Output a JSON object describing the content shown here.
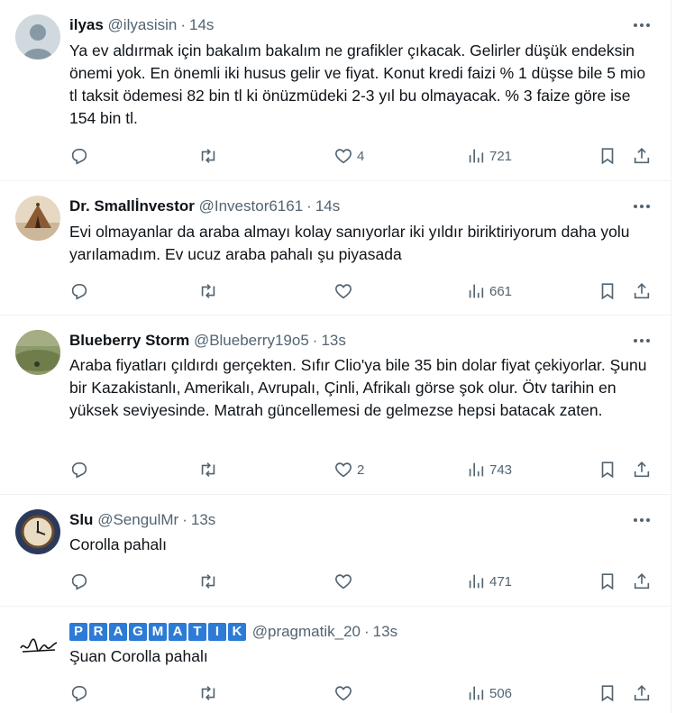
{
  "tweets": [
    {
      "name": "ilyas",
      "handle": "@ilyasisin",
      "time": "14s",
      "text": "Ya ev aldırmak için bakalım bakalım ne grafikler çıkacak. Gelirler düşük endeksin önemi yok. En önemli iki husus gelir ve fiyat. Konut kredi faizi % 1 düşse bile 5 mio tl taksit ödemesi 82 bin tl ki önüzmüdeki 2-3 yıl bu olmayacak. % 3 faize göre ise 154 bin tl.",
      "likes": "4",
      "views": "721",
      "avatar": "default-avatar"
    },
    {
      "name": "Dr. Smallİnvestor",
      "handle": "@Investor6161",
      "time": "14s",
      "text": "Evi olmayanlar da araba almayı kolay sanıyorlar iki yıldır biriktiriyorum daha yolu yarılamadım. Ev ucuz araba pahalı şu piyasada",
      "likes": "",
      "views": "661",
      "avatar": "tent-photo"
    },
    {
      "name": "Blueberry Storm",
      "handle": "@Blueberry19o5",
      "time": "13s",
      "text": "Araba fiyatları çıldırdı gerçekten. Sıfır Clio'ya bile 35 bin dolar fiyat çekiyorlar. Şunu bir Kazakistanlı, Amerikalı, Avrupalı, Çinli, Afrikalı görse şok olur. Ötv tarihin en yüksek seviyesinde. Matrah güncellemesi de gelmezse hepsi batacak zaten.",
      "likes": "2",
      "views": "743",
      "avatar": "field-photo"
    },
    {
      "name": "Slu",
      "handle": "@SengulMr",
      "time": "13s",
      "text": "Corolla pahalı",
      "likes": "",
      "views": "471",
      "avatar": "clock-photo"
    },
    {
      "name": "PRAGMATIK",
      "handle": "@pragmatik_20",
      "time": "13s",
      "text": "Şuan Corolla pahalı",
      "likes": "",
      "views": "506",
      "avatar": "signature-logo",
      "name_letters": [
        "P",
        "R",
        "A",
        "G",
        "M",
        "A",
        "T",
        "I",
        "K"
      ]
    }
  ],
  "colors": {
    "text": "#0f1419",
    "secondary": "#536471",
    "divider": "#eff3f4",
    "pragmatik_blue": "#2c7bd6"
  },
  "dot_separator": "·",
  "icons": [
    "more-icon",
    "reply-icon",
    "retweet-icon",
    "like-icon",
    "views-icon",
    "bookmark-icon",
    "share-icon"
  ]
}
